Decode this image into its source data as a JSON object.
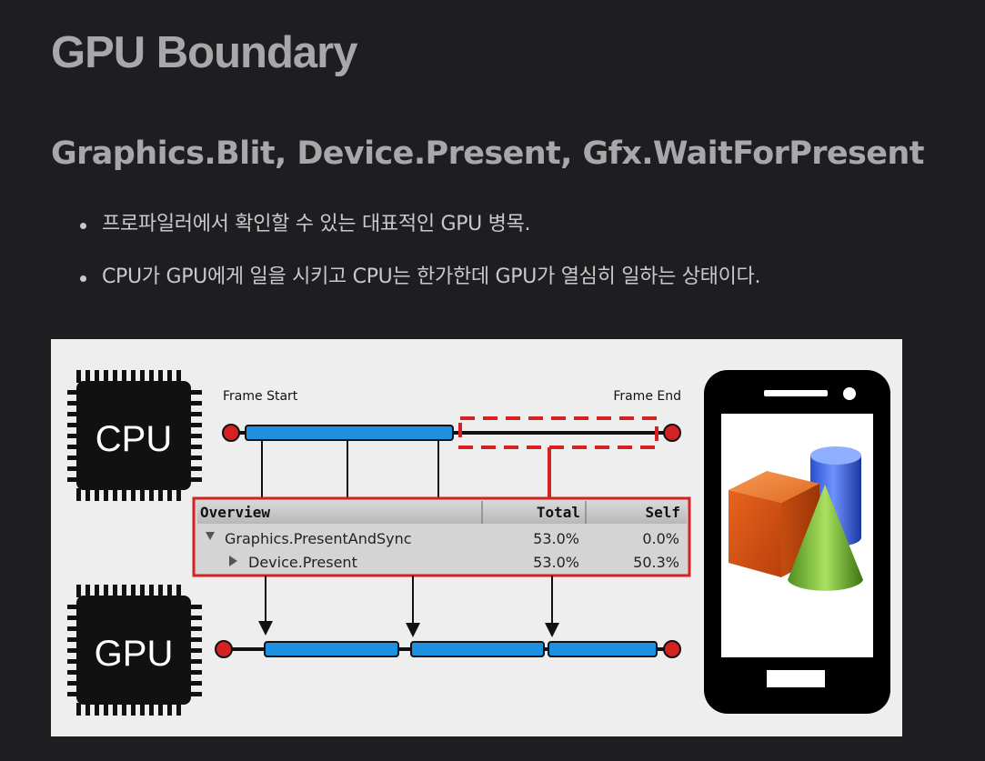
{
  "page": {
    "title": "GPU Boundary",
    "subtitle": "Graphics.Blit, Device.Present, Gfx.WaitForPresent",
    "bullets": [
      "프로파일러에서 확인할 수 있는 대표적인 GPU 병목.",
      "CPU가 GPU에게 일을 시키고 CPU는 한가한데 GPU가 열심히 일하는 상태이다."
    ]
  },
  "figure": {
    "cpu_label": "CPU",
    "gpu_label": "GPU",
    "frame_start": "Frame Start",
    "frame_end": "Frame End",
    "profiler": {
      "headers": [
        "Overview",
        "Total",
        "Self"
      ],
      "rows": [
        {
          "name": "Graphics.PresentAndSync",
          "total": "53.0%",
          "self": "0.0%"
        },
        {
          "name": "Device.Present",
          "total": "53.0%",
          "self": "50.3%"
        }
      ]
    },
    "colors": {
      "bar_blue": "#1e90e0",
      "accent_red": "#d42222",
      "chip_black": "#111111"
    },
    "icons": [
      "cpu-chip-icon",
      "gpu-chip-icon",
      "smartphone-icon",
      "cube-icon",
      "cylinder-icon",
      "cone-icon"
    ]
  }
}
